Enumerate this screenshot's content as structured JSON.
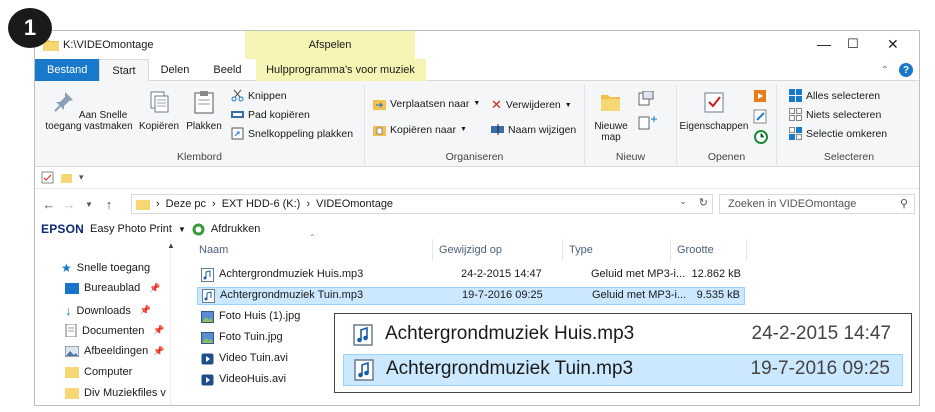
{
  "step_number": "1",
  "window": {
    "title": "K:\\VIDEOmontage",
    "context_tool": "Afspelen",
    "controls": {
      "minimize": "—",
      "maximize": "☐",
      "close": "✕"
    }
  },
  "tabs": [
    {
      "label": "Bestand"
    },
    {
      "label": "Start"
    },
    {
      "label": "Delen"
    },
    {
      "label": "Beeld"
    },
    {
      "label": "Hulpprogramma's voor muziek"
    }
  ],
  "ribbon": {
    "clipboard": {
      "label": "Klembord",
      "pin": "Aan Snelle toegang vastmaken",
      "copy": "Kopiëren",
      "paste": "Plakken",
      "cut": "Knippen",
      "copy_path": "Pad kopiëren",
      "paste_shortcut": "Snelkoppeling plakken"
    },
    "organize": {
      "label": "Organiseren",
      "move_to": "Verplaatsen naar",
      "copy_to": "Kopiëren naar",
      "delete": "Verwijderen",
      "rename": "Naam wijzigen"
    },
    "new": {
      "label": "Nieuw",
      "new_folder": "Nieuwe map"
    },
    "open": {
      "label": "Openen",
      "properties": "Eigenschappen"
    },
    "select": {
      "label": "Selecteren",
      "select_all": "Alles selecteren",
      "select_none": "Niets selecteren",
      "invert": "Selectie omkeren"
    }
  },
  "address": {
    "crumbs": [
      "Deze pc",
      "EXT HDD-6 (K:)",
      "VIDEOmontage"
    ],
    "search_placeholder": "Zoeken in VIDEOmontage"
  },
  "epson": {
    "brand": "EPSON",
    "app": "Easy Photo Print",
    "print": "Afdrukken"
  },
  "nav": {
    "items": [
      {
        "label": "Snelle toegang"
      },
      {
        "label": "Bureaublad"
      },
      {
        "label": "Downloads"
      },
      {
        "label": "Documenten"
      },
      {
        "label": "Afbeeldingen"
      },
      {
        "label": "Computer"
      },
      {
        "label": "Div Muziekfiles v"
      }
    ]
  },
  "columns": {
    "name": "Naam",
    "modified": "Gewijzigd op",
    "type": "Type",
    "size": "Grootte"
  },
  "files": [
    {
      "name": "Achtergrondmuziek Huis.mp3",
      "modified": "24-2-2015 14:47",
      "type": "Geluid met MP3-i...",
      "size": "12.862 kB"
    },
    {
      "name": "Achtergrondmuziek Tuin.mp3",
      "modified": "19-7-2016 09:25",
      "type": "Geluid met MP3-i...",
      "size": "9.535 kB"
    },
    {
      "name": "Foto Huis (1).jpg",
      "modified": "",
      "type": "",
      "size": ""
    },
    {
      "name": "Foto Tuin.jpg",
      "modified": "",
      "type": "",
      "size": ""
    },
    {
      "name": "Video Tuin.avi",
      "modified": "",
      "type": "",
      "size": ""
    },
    {
      "name": "VideoHuis.avi",
      "modified": "",
      "type": "",
      "size": ""
    }
  ],
  "zoom": [
    {
      "name": "Achtergrondmuziek Huis.mp3",
      "modified": "24-2-2015 14:47"
    },
    {
      "name": "Achtergrondmuziek Tuin.mp3",
      "modified": "19-7-2016 09:25"
    }
  ],
  "colors": {
    "accent": "#1979ca",
    "selection": "#cce8ff",
    "selection_border": "#99d1ff",
    "context_tab": "#f5f4b4"
  }
}
